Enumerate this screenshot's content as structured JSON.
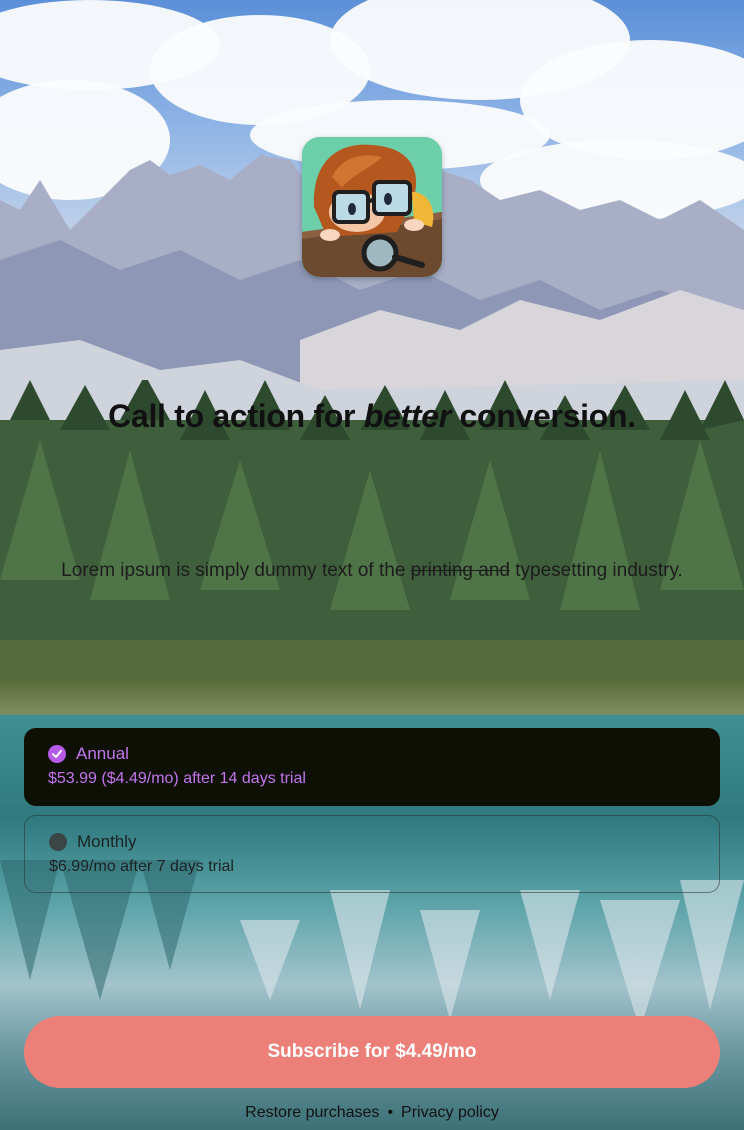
{
  "header": {
    "app_icon": "detective-kid-app-icon"
  },
  "headline": {
    "part1": "Call to action for ",
    "emphasis": "better",
    "part2": " conversion."
  },
  "subtitle": {
    "before": "Lorem ipsum is simply dummy text of the ",
    "struck": "printing and",
    "after": " typesetting industry."
  },
  "plans": [
    {
      "name": "Annual",
      "price": "$53.99 ($4.49/mo) after 14 days trial",
      "selected": true
    },
    {
      "name": "Monthly",
      "price": "$6.99/mo after 7 days trial",
      "selected": false
    }
  ],
  "cta": {
    "label": "Subscribe for $4.49/mo"
  },
  "footer": {
    "restore": "Restore purchases",
    "separator": "•",
    "privacy": "Privacy policy"
  },
  "colors": {
    "accent": "#b55be8",
    "cta": "#ec7f78",
    "selected_bg": "#0f1004"
  }
}
